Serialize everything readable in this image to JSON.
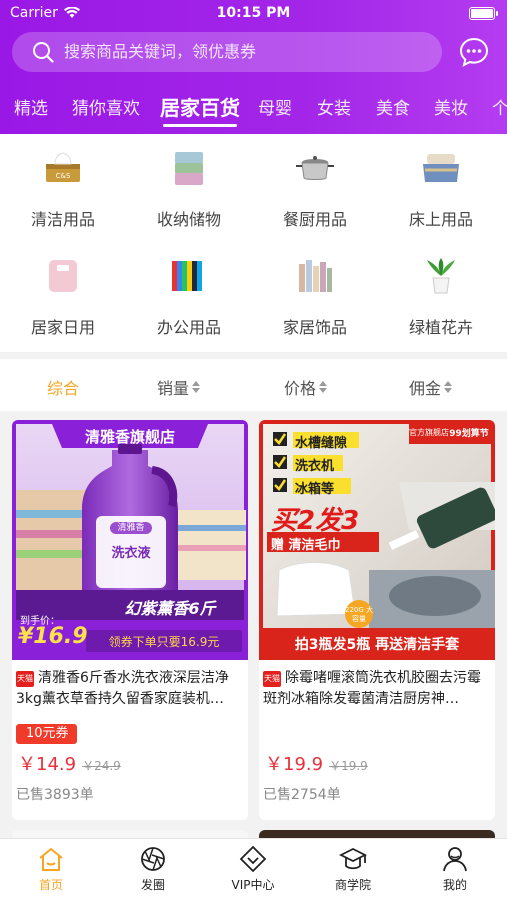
{
  "status_bar": {
    "carrier": "Carrier",
    "time": "10:15 PM"
  },
  "search": {
    "placeholder": "搜索商品关键词，领优惠券"
  },
  "tabs": [
    {
      "label": "精选"
    },
    {
      "label": "猜你喜欢"
    },
    {
      "label": "居家百货",
      "active": true
    },
    {
      "label": "母婴"
    },
    {
      "label": "女装"
    },
    {
      "label": "美食"
    },
    {
      "label": "美妆"
    },
    {
      "label": "个"
    }
  ],
  "categories": [
    {
      "label": "清洁用品",
      "icon": "tissue-box-icon"
    },
    {
      "label": "收纳储物",
      "icon": "storage-box-icon"
    },
    {
      "label": "餐厨用品",
      "icon": "cooking-pot-icon"
    },
    {
      "label": "床上用品",
      "icon": "bedding-icon"
    },
    {
      "label": "居家日用",
      "icon": "scale-icon"
    },
    {
      "label": "办公用品",
      "icon": "folders-icon"
    },
    {
      "label": "家居饰品",
      "icon": "wallpaper-rolls-icon"
    },
    {
      "label": "绿植花卉",
      "icon": "potted-plant-icon"
    }
  ],
  "sort": [
    {
      "label": "综合",
      "active": true
    },
    {
      "label": "销量"
    },
    {
      "label": "价格"
    },
    {
      "label": "佣金"
    }
  ],
  "products": [
    {
      "shop_banner": "清雅香旗舰店",
      "brand_badge": "清雅香",
      "bottle_label": "洗衣液",
      "promo_strip": "幻紫薰香6斤",
      "promo_sub": "领券下单只要16.9元",
      "hand_price_label": "到手价：",
      "hand_price": "¥16.9",
      "store_tag": "天猫",
      "title": "清雅香6斤香水洗衣液深层洁净3kg薰衣草香持久留香家庭装机…",
      "coupon": "10元券",
      "price": "￥14.9",
      "original_price": "￥24.9",
      "sold": "已售3893单"
    },
    {
      "badge_left": "官方旗舰店",
      "badge_right": "99划算节",
      "checks": [
        "水槽缝隙",
        "洗衣机",
        "冰箱等"
      ],
      "buy_promo": "买2发3",
      "gift": "赠 清洁毛巾",
      "volume_tag": "220G 大容量",
      "bottom_strip": "拍3瓶发5瓶 再送清洁手套",
      "store_tag": "天猫",
      "title": "除霉啫喱滚筒洗衣机胶圈去污霉斑剂冰箱除发霉菌清洁厨房神…",
      "price": "￥19.9",
      "original_price": "￥19.9",
      "sold": "已售2754单"
    }
  ],
  "tabbar": [
    {
      "label": "首页",
      "icon": "home-icon",
      "active": true
    },
    {
      "label": "发圈",
      "icon": "aperture-icon"
    },
    {
      "label": "VIP中心",
      "icon": "vip-diamond-icon"
    },
    {
      "label": "商学院",
      "icon": "graduation-cap-icon"
    },
    {
      "label": "我的",
      "icon": "user-icon"
    }
  ],
  "colors": {
    "brand_purple": "#9a18e6",
    "accent_orange": "#f5a623",
    "price_red": "#e8313a"
  }
}
